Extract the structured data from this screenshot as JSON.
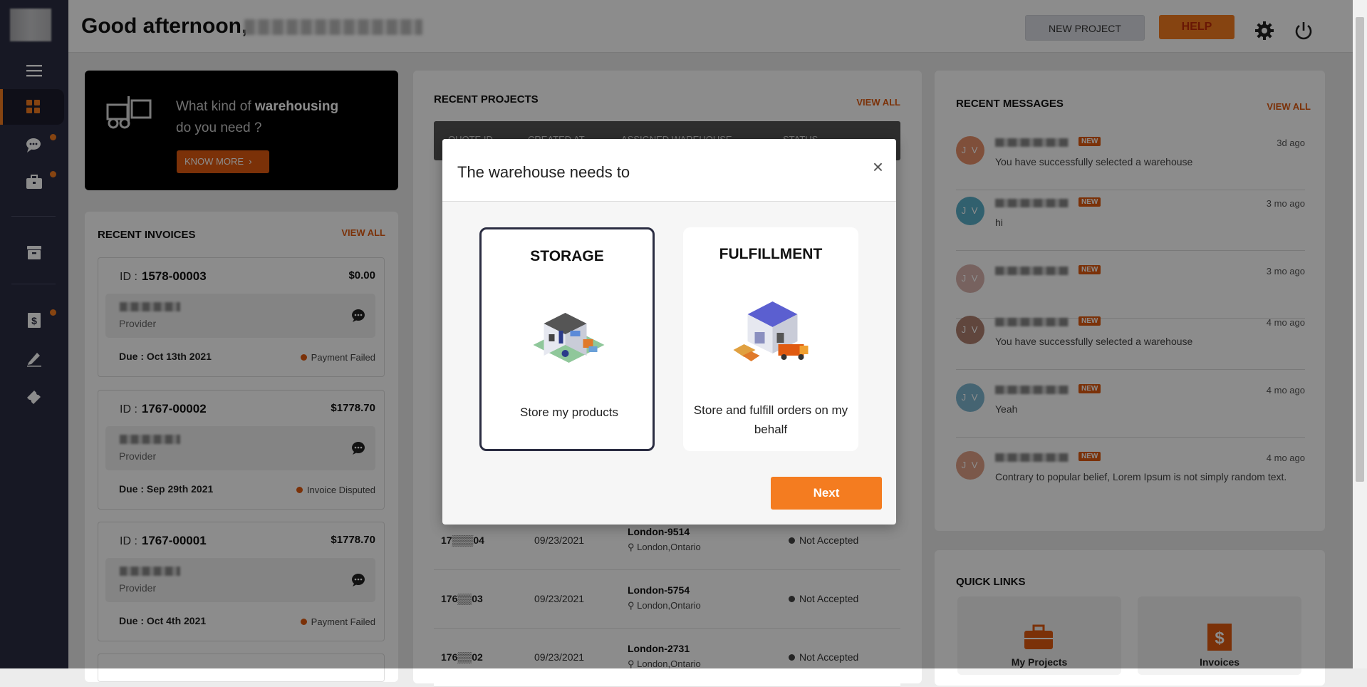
{
  "header": {
    "greeting": "Good afternoon,",
    "new_project": "NEW PROJECT",
    "help": "HELP"
  },
  "promo": {
    "line1_prefix": "What kind of ",
    "line1_bold": "warehousing",
    "line2": "do you need ?",
    "button": "KNOW MORE"
  },
  "invoices": {
    "title": "RECENT INVOICES",
    "view_all": "VIEW ALL",
    "items": [
      {
        "id_label": "ID :",
        "id": "1578-00003",
        "amount": "$0.00",
        "provider_label": "Provider",
        "due": "Due : Oct 13th 2021",
        "status": "Payment Failed"
      },
      {
        "id_label": "ID :",
        "id": "1767-00002",
        "amount": "$1778.70",
        "provider_label": "Provider",
        "due": "Due : Sep 29th 2021",
        "status": "Invoice Disputed"
      },
      {
        "id_label": "ID :",
        "id": "1767-00001",
        "amount": "$1778.70",
        "provider_label": "Provider",
        "due": "Due : Oct 4th 2021",
        "status": "Payment Failed"
      }
    ]
  },
  "projects": {
    "title": "RECENT PROJECTS",
    "view_all": "VIEW ALL",
    "columns": [
      "QUOTE ID",
      "CREATED AT",
      "ASSIGNED WAREHOUSE",
      "STATUS"
    ],
    "rows": [
      {
        "quote": "17▒▒▒04",
        "date": "09/23/2021",
        "warehouse": "London-9514",
        "location": "London,Ontario",
        "status": "Not Accepted"
      },
      {
        "quote": "176▒▒03",
        "date": "09/23/2021",
        "warehouse": "London-5754",
        "location": "London,Ontario",
        "status": "Not Accepted"
      },
      {
        "quote": "176▒▒02",
        "date": "09/23/2021",
        "warehouse": "London-2731",
        "location": "London,Ontario",
        "status": "Not Accepted"
      }
    ]
  },
  "messages": {
    "title": "RECENT MESSAGES",
    "view_all": "VIEW ALL",
    "new_badge": "NEW",
    "items": [
      {
        "initials": "J V",
        "color": "#e8906a",
        "time": "3d ago",
        "text": "You have successfully selected a warehouse"
      },
      {
        "initials": "J V",
        "color": "#5ab0c8",
        "time": "3 mo ago",
        "text": "hi"
      },
      {
        "initials": "J V",
        "color": "#d9b3ae",
        "time": "3 mo ago",
        "text": ""
      },
      {
        "initials": "J V",
        "color": "#b08070",
        "time": "4 mo ago",
        "text": "You have successfully selected a warehouse"
      },
      {
        "initials": "J V",
        "color": "#7fb6d0",
        "time": "4 mo ago",
        "text": "Yeah"
      },
      {
        "initials": "J V",
        "color": "#e0a088",
        "time": "4 mo ago",
        "text": "Contrary to popular belief, Lorem Ipsum is not simply random text."
      }
    ]
  },
  "quick_links": {
    "title": "QUICK LINKS",
    "items": [
      "My Projects",
      "Invoices"
    ]
  },
  "modal": {
    "title": "The warehouse needs to",
    "close": "×",
    "options": [
      {
        "title": "STORAGE",
        "desc": "Store my products",
        "selected": true
      },
      {
        "title": "FULFILLMENT",
        "desc": "Store and fulfill orders on my behalf",
        "selected": false
      }
    ],
    "next": "Next"
  },
  "colors": {
    "accent": "#f47c20",
    "sidebar": "#2b2d42"
  }
}
